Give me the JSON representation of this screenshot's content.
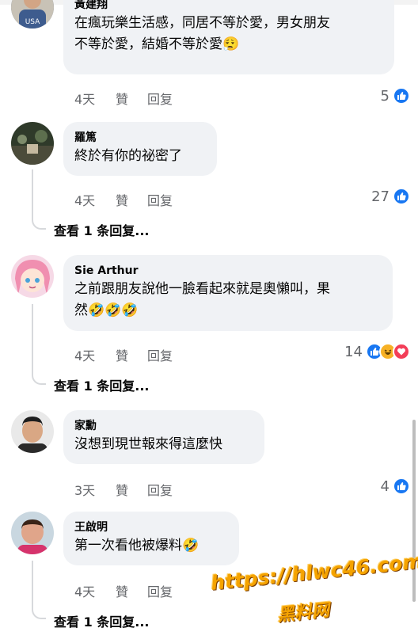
{
  "comments": [
    {
      "author": "黃建翔",
      "text_lines": [
        "在瘋玩樂生活感，同居不等於愛，男女朋友",
        "不等於愛，結婚不等於愛😮‍💨"
      ],
      "time": "4天",
      "like": "贊",
      "reply": "回复",
      "reaction_count": "5",
      "reactions": [
        "like-icon"
      ]
    },
    {
      "author": "羅篤",
      "text_lines": [
        "終於有你的祕密了"
      ],
      "time": "4天",
      "like": "贊",
      "reply": "回复",
      "reaction_count": "27",
      "reactions": [
        "like-icon"
      ],
      "view_replies": "查看 1 条回复..."
    },
    {
      "author": "Sie Arthur",
      "text_lines": [
        "之前跟朋友說他一臉看起來就是奧懶叫，果",
        "然🤣🤣🤣"
      ],
      "time": "4天",
      "like": "贊",
      "reply": "回复",
      "reaction_count": "14",
      "reactions": [
        "like-icon",
        "haha-icon",
        "love-icon"
      ],
      "view_replies": "查看 1 条回复..."
    },
    {
      "author": "家勳",
      "text_lines": [
        "沒想到現世報來得這麼快"
      ],
      "time": "3天",
      "like": "贊",
      "reply": "回复",
      "reaction_count": "4",
      "reactions": [
        "like-icon"
      ]
    },
    {
      "author": "王啟明",
      "text_lines": [
        "第一次看他被爆料🤣"
      ],
      "time": "4天",
      "like": "贊",
      "reply": "回复",
      "reaction_count": "",
      "reactions": [],
      "view_replies": "查看 1 条回复..."
    }
  ],
  "watermark": {
    "url": "https://hlwc46.com",
    "name": "黑料网"
  },
  "colors": {
    "like_blue": "#1877f2",
    "love_red": "#f33e58",
    "haha_yellow": "#f7b125",
    "bubble": "#f0f2f5",
    "meta_gray": "#65676b"
  }
}
